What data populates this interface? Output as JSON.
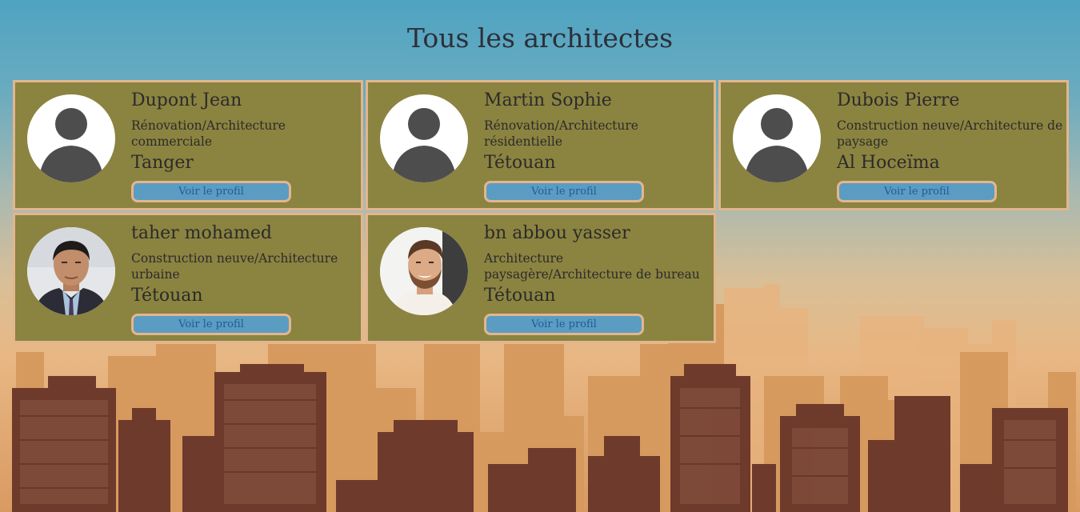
{
  "page": {
    "title": "Tous les architectes"
  },
  "colors": {
    "card_background": "#8b8340",
    "card_border": "#e2b68e",
    "button_background": "#5b9cc2",
    "button_text": "#1f5b9a",
    "title_text": "#2c2f3a"
  },
  "architects": [
    {
      "name": "Dupont Jean",
      "specialty": "Rénovation/Architecture commerciale",
      "city": "Tanger",
      "button_label": "Voir le profil",
      "avatar": "default-person-icon"
    },
    {
      "name": "Martin Sophie",
      "specialty": "Rénovation/Architecture résidentielle",
      "city": "Tétouan",
      "button_label": "Voir le profil",
      "avatar": "default-person-icon"
    },
    {
      "name": "Dubois Pierre",
      "specialty": "Construction neuve/Architecture de paysage",
      "city": "Al Hoceïma",
      "button_label": "Voir le profil",
      "avatar": "default-person-icon"
    },
    {
      "name": "taher mohamed",
      "specialty": "Construction neuve/Architecture urbaine",
      "city": "Tétouan",
      "button_label": "Voir le profil",
      "avatar": "photo-man-suit"
    },
    {
      "name": "bn abbou yasser",
      "specialty": "Architecture paysagère/Architecture de bureau",
      "city": "Tétouan",
      "button_label": "Voir le profil",
      "avatar": "photo-man-beard"
    }
  ]
}
